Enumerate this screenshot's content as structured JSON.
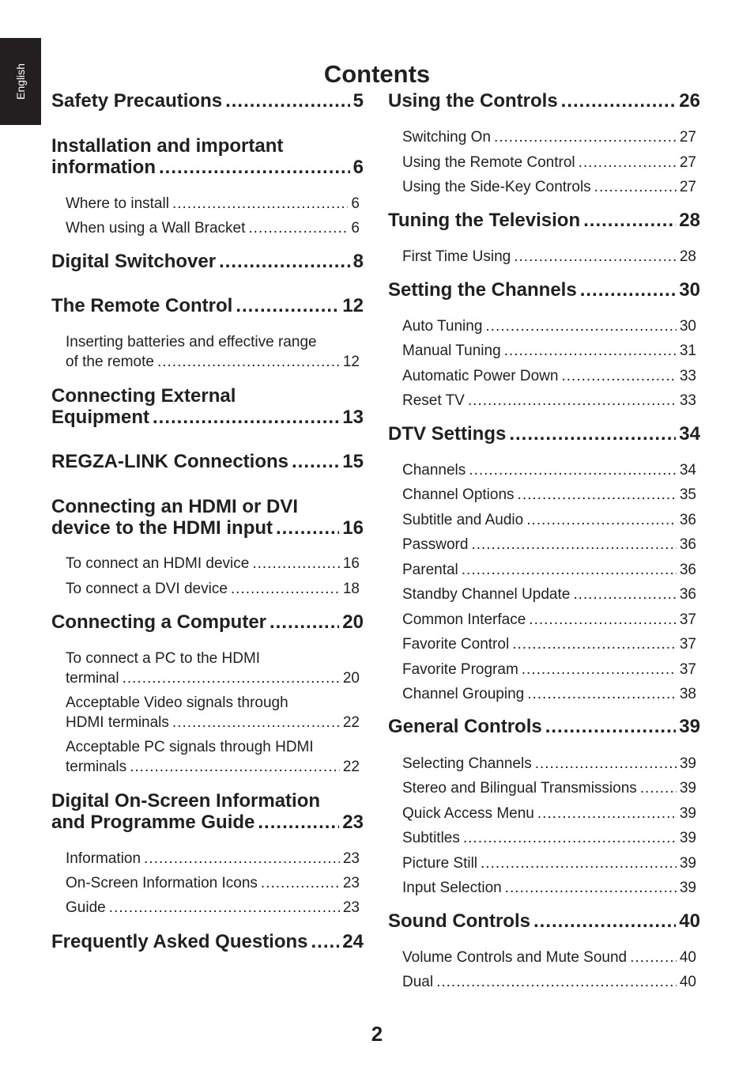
{
  "side_tab": {
    "label": "English"
  },
  "title": "Contents",
  "page_number": "2",
  "left_column": [
    {
      "level": "main",
      "lines": [
        "Safety Precautions"
      ],
      "page": "5"
    },
    {
      "level": "main",
      "lines": [
        "Installation and important",
        "information"
      ],
      "page": "6"
    },
    {
      "level": "sub",
      "lines": [
        "Where to install"
      ],
      "page": "6"
    },
    {
      "level": "sub",
      "lines": [
        "When using a Wall Bracket"
      ],
      "page": "6"
    },
    {
      "level": "main",
      "lines": [
        "Digital Switchover"
      ],
      "page": "8"
    },
    {
      "level": "main",
      "lines": [
        "The Remote Control"
      ],
      "page": "12"
    },
    {
      "level": "sub",
      "lines": [
        "Inserting batteries and effective range",
        "of the remote"
      ],
      "page": "12"
    },
    {
      "level": "main",
      "lines": [
        "Connecting External",
        "Equipment"
      ],
      "page": "13"
    },
    {
      "level": "main",
      "lines": [
        "REGZA-LINK Connections"
      ],
      "page": "15"
    },
    {
      "level": "main",
      "lines": [
        "Connecting an HDMI or DVI",
        "device to the HDMI input"
      ],
      "page": "16"
    },
    {
      "level": "sub",
      "lines": [
        "To connect an HDMI device"
      ],
      "page": "16"
    },
    {
      "level": "sub",
      "lines": [
        "To connect a DVI device"
      ],
      "page": "18"
    },
    {
      "level": "main",
      "lines": [
        "Connecting a Computer"
      ],
      "page": "20"
    },
    {
      "level": "sub",
      "lines": [
        "To connect a PC to the HDMI",
        "terminal"
      ],
      "page": "20"
    },
    {
      "level": "sub",
      "lines": [
        "Acceptable Video signals through",
        "HDMI terminals"
      ],
      "page": "22"
    },
    {
      "level": "sub",
      "lines": [
        "Acceptable PC signals through HDMI",
        "terminals"
      ],
      "page": "22"
    },
    {
      "level": "main",
      "lines": [
        "Digital On-Screen Information",
        "and Programme Guide"
      ],
      "page": "23"
    },
    {
      "level": "sub",
      "lines": [
        "Information"
      ],
      "page": "23"
    },
    {
      "level": "sub",
      "lines": [
        "On-Screen Information Icons"
      ],
      "page": "23"
    },
    {
      "level": "sub",
      "lines": [
        "Guide"
      ],
      "page": "23"
    },
    {
      "level": "main",
      "lines": [
        "Frequently Asked Questions"
      ],
      "page": "24"
    }
  ],
  "right_column": [
    {
      "level": "main",
      "lines": [
        "Using the Controls"
      ],
      "page": "26"
    },
    {
      "level": "sub",
      "lines": [
        "Switching On"
      ],
      "page": "27"
    },
    {
      "level": "sub",
      "lines": [
        "Using the Remote Control"
      ],
      "page": "27"
    },
    {
      "level": "sub",
      "lines": [
        "Using the Side-Key Controls"
      ],
      "page": "27"
    },
    {
      "level": "main",
      "lines": [
        "Tuning the Television"
      ],
      "page": "28"
    },
    {
      "level": "sub",
      "lines": [
        "First Time Using"
      ],
      "page": "28"
    },
    {
      "level": "main",
      "lines": [
        "Setting the Channels"
      ],
      "page": "30"
    },
    {
      "level": "sub",
      "lines": [
        "Auto Tuning"
      ],
      "page": "30"
    },
    {
      "level": "sub",
      "lines": [
        "Manual Tuning"
      ],
      "page": "31"
    },
    {
      "level": "sub",
      "lines": [
        "Automatic Power Down"
      ],
      "page": "33"
    },
    {
      "level": "sub",
      "lines": [
        "Reset TV"
      ],
      "page": "33"
    },
    {
      "level": "main",
      "lines": [
        "DTV Settings"
      ],
      "page": "34"
    },
    {
      "level": "sub",
      "lines": [
        "Channels"
      ],
      "page": "34"
    },
    {
      "level": "sub",
      "lines": [
        "Channel Options"
      ],
      "page": "35"
    },
    {
      "level": "sub",
      "lines": [
        "Subtitle and Audio"
      ],
      "page": "36"
    },
    {
      "level": "sub",
      "lines": [
        "Password"
      ],
      "page": "36"
    },
    {
      "level": "sub",
      "lines": [
        "Parental"
      ],
      "page": "36"
    },
    {
      "level": "sub",
      "lines": [
        "Standby Channel Update"
      ],
      "page": "36"
    },
    {
      "level": "sub",
      "lines": [
        "Common Interface"
      ],
      "page": "37"
    },
    {
      "level": "sub",
      "lines": [
        "Favorite Control"
      ],
      "page": "37"
    },
    {
      "level": "sub",
      "lines": [
        "Favorite Program"
      ],
      "page": "37"
    },
    {
      "level": "sub",
      "lines": [
        "Channel Grouping"
      ],
      "page": "38"
    },
    {
      "level": "main",
      "lines": [
        "General Controls"
      ],
      "page": "39"
    },
    {
      "level": "sub",
      "lines": [
        "Selecting Channels"
      ],
      "page": "39"
    },
    {
      "level": "sub",
      "lines": [
        "Stereo and Bilingual Transmissions"
      ],
      "page": "39"
    },
    {
      "level": "sub",
      "lines": [
        "Quick Access Menu"
      ],
      "page": "39"
    },
    {
      "level": "sub",
      "lines": [
        "Subtitles"
      ],
      "page": "39"
    },
    {
      "level": "sub",
      "lines": [
        "Picture Still"
      ],
      "page": "39"
    },
    {
      "level": "sub",
      "lines": [
        "Input Selection"
      ],
      "page": "39"
    },
    {
      "level": "main",
      "lines": [
        "Sound Controls"
      ],
      "page": "40"
    },
    {
      "level": "sub",
      "lines": [
        "Volume Controls and Mute Sound"
      ],
      "page": "40"
    },
    {
      "level": "sub",
      "lines": [
        "Dual"
      ],
      "page": "40"
    }
  ]
}
